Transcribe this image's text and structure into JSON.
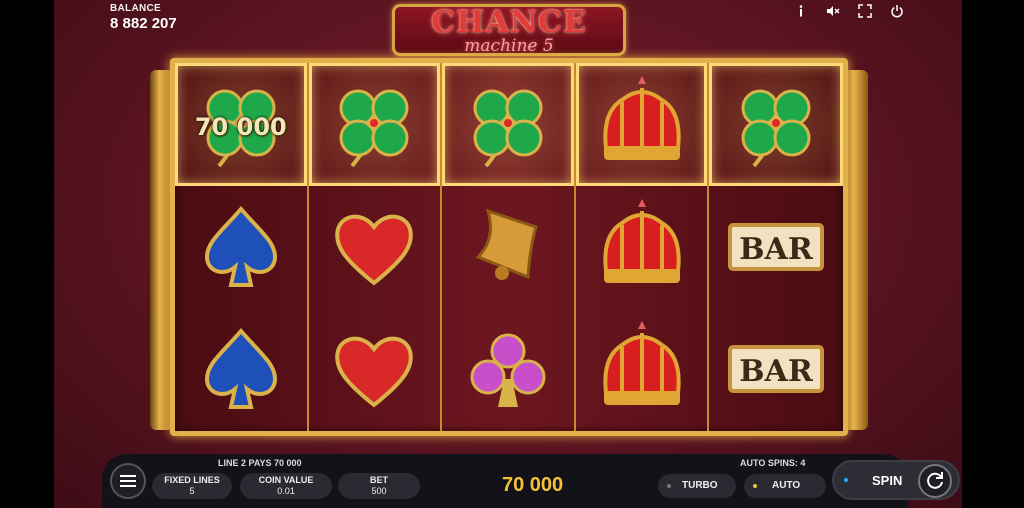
{
  "balance": {
    "label": "BALANCE",
    "value": "8 882 207"
  },
  "logo": {
    "title": "CHANCE",
    "subtitle": "machine 5"
  },
  "top_icons": [
    {
      "name": "info-icon"
    },
    {
      "name": "mute-icon"
    },
    {
      "name": "fullscreen-icon"
    },
    {
      "name": "power-icon"
    }
  ],
  "reels": [
    [
      "clover",
      "spade",
      "spade"
    ],
    [
      "clover",
      "heart",
      "heart"
    ],
    [
      "clover",
      "bell",
      "club"
    ],
    [
      "crown",
      "crown",
      "crown"
    ],
    [
      "clover",
      "bar",
      "bar"
    ]
  ],
  "winning_row": 0,
  "win_amount_label": "70 000",
  "symbol_text": {
    "bar": "BAR"
  },
  "colors": {
    "gold": "#e3b14a",
    "win_yellow": "#f5c23a",
    "bg_red": "#5a1420"
  },
  "bottom": {
    "line_info": "LINE 2 PAYS 70 000",
    "auto_info": "AUTO SPINS: 4",
    "fixed_lines_label": "FIXED LINES",
    "fixed_lines_value": "5",
    "coin_value_label": "COIN VALUE",
    "coin_value_value": "0.01",
    "bet_label": "BET",
    "bet_value": "500",
    "win_total": "70 000",
    "turbo_label": "TURBO",
    "auto_label": "AUTO",
    "spin_label": "SPIN"
  }
}
